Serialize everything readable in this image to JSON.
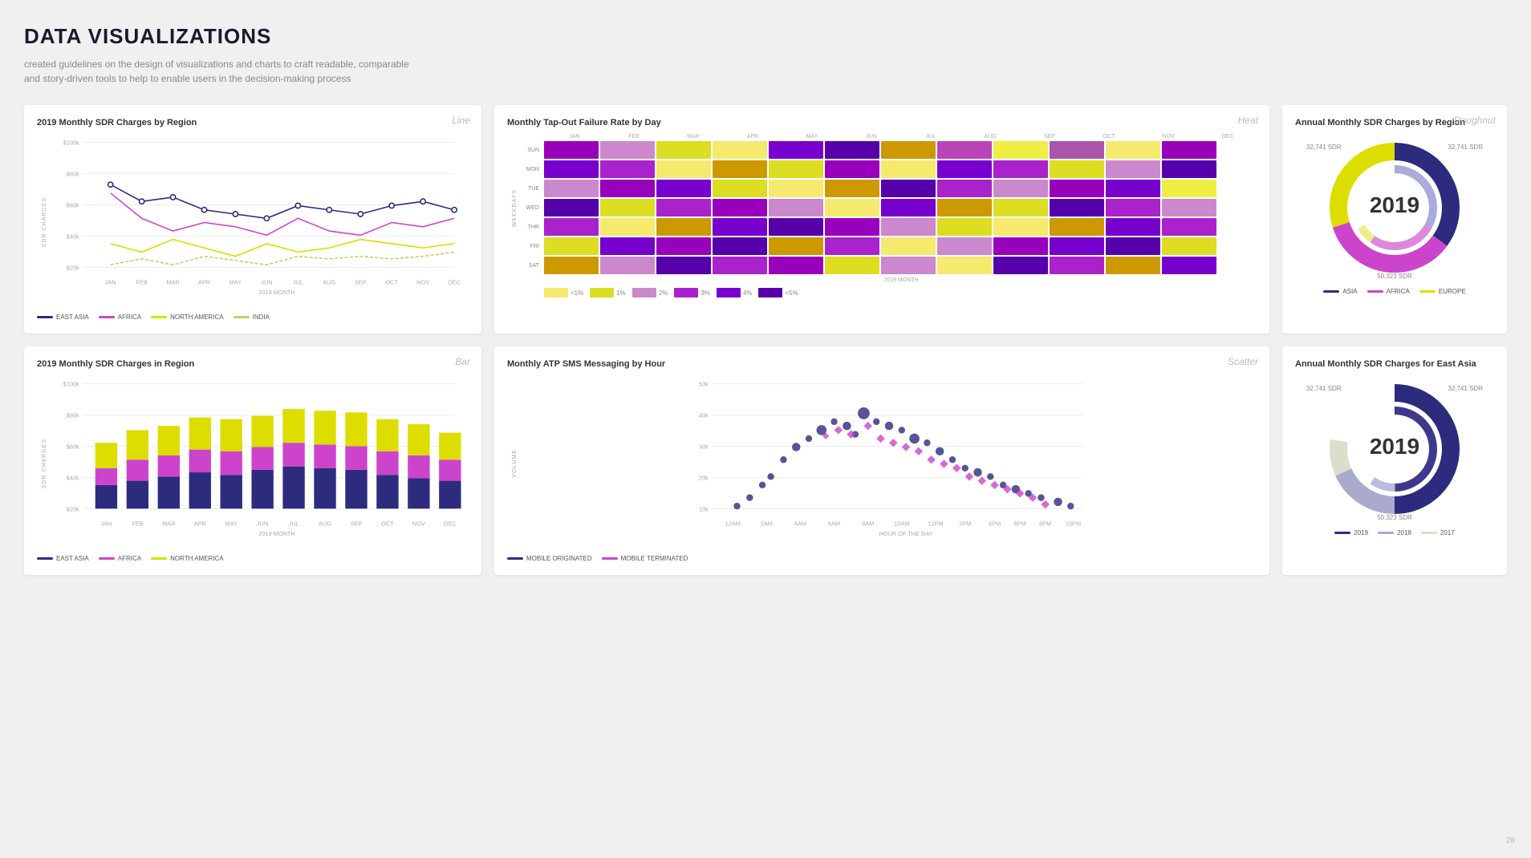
{
  "page": {
    "title": "DATA VISUALIZATIONS",
    "subtitle": "created guidelines on the design of visualizations and charts to craft readable, comparable and story-driven tools to help to enable users in the decision-making process",
    "page_number": "28"
  },
  "charts": {
    "line": {
      "type_label": "Line",
      "title": "2019 Monthly SDR Charges by Region",
      "y_axis_label": "SDR CHARGES",
      "x_axis_label": "2019 MONTH",
      "x_labels": [
        "JAN",
        "FEB",
        "MAR",
        "APR",
        "MAY",
        "JUN",
        "JUL",
        "AUG",
        "SEP",
        "OCT",
        "NOV",
        "DEC"
      ],
      "y_labels": [
        "$100k",
        "$80k",
        "$60k",
        "$40k",
        "$20k"
      ],
      "legend": [
        {
          "label": "EAST ASIA",
          "color": "#2d2b7e"
        },
        {
          "label": "AFRICA",
          "color": "#cc44cc"
        },
        {
          "label": "NORTH AMERICA",
          "color": "#dddd44"
        },
        {
          "label": "INDIA",
          "color": "#dddd44"
        }
      ]
    },
    "heat": {
      "type_label": "Heat",
      "title": "Monthly Tap-Out Failure Rate by Day",
      "y_labels": [
        "SUN",
        "MON",
        "TUE",
        "WED",
        "THR",
        "FRI",
        "SAT"
      ],
      "x_labels": [
        "JAN",
        "FEB",
        "MAR",
        "APR",
        "MAY",
        "JUN",
        "JUL",
        "AUG",
        "SEP",
        "OCT",
        "NOV",
        "DEC"
      ],
      "x_axis_label": "2019 MONTH",
      "legend": [
        "<1%",
        "1%",
        "2%",
        "3%",
        "4%",
        "<5%"
      ]
    },
    "doughnut1": {
      "type_label": "Doughnut",
      "title": "Annual Monthly SDR Charges by Region",
      "center_label": "2019",
      "top_left_val": "32,741 SDR",
      "top_right_val": "32,741 SDR",
      "bottom_val": "50,323 SDR",
      "legend": [
        {
          "label": "ASIA",
          "color": "#2d2b7e"
        },
        {
          "label": "AFRICA",
          "color": "#cc44cc"
        },
        {
          "label": "EUROPE",
          "color": "#dddd44"
        }
      ]
    },
    "bar": {
      "type_label": "Bar",
      "title": "2019 Monthly SDR Charges in Region",
      "y_axis_label": "SDR CHARGES",
      "x_axis_label": "2019 MONTH",
      "x_labels": [
        "JAN",
        "FEB",
        "MAR",
        "APR",
        "MAY",
        "JUN",
        "JUL",
        "AUG",
        "SEP",
        "OCT",
        "NOV",
        "DEC"
      ],
      "y_labels": [
        "$100k",
        "$80k",
        "$60k",
        "$40k",
        "$20k"
      ],
      "legend": [
        {
          "label": "EAST ASIA",
          "color": "#2d2b7e"
        },
        {
          "label": "AFRICA",
          "color": "#cc44cc"
        },
        {
          "label": "NORTH AMERICA",
          "color": "#dddd44"
        }
      ]
    },
    "scatter": {
      "type_label": "Scatter",
      "title": "Monthly ATP SMS Messaging by Hour",
      "y_axis_label": "VOLUME",
      "x_axis_label": "HOUR OF THE DAY",
      "x_labels": [
        "12AM",
        "2AM",
        "4AM",
        "6AM",
        "8AM",
        "10AM",
        "12PM",
        "2PM",
        "4PM",
        "6PM",
        "8PM",
        "10PM"
      ],
      "y_labels": [
        "50k",
        "40k",
        "30k",
        "20k",
        "10k"
      ],
      "legend": [
        {
          "label": "MOBILE ORIGINATED",
          "color": "#3d3b8e"
        },
        {
          "label": "MOBILE TERMINATED",
          "color": "#cc44cc"
        }
      ]
    },
    "doughnut2": {
      "title": "Annual Monthly SDR Charges for East Asia",
      "center_label": "2019",
      "top_left_val": "32,741 SDR",
      "top_right_val": "32,741 SDR",
      "bottom_val": "50,323 SDR",
      "legend": [
        {
          "label": "2019",
          "color": "#2d2b7e"
        },
        {
          "label": "2018",
          "color": "#aaaacc"
        },
        {
          "label": "2017",
          "color": "#ddddcc"
        }
      ]
    }
  }
}
